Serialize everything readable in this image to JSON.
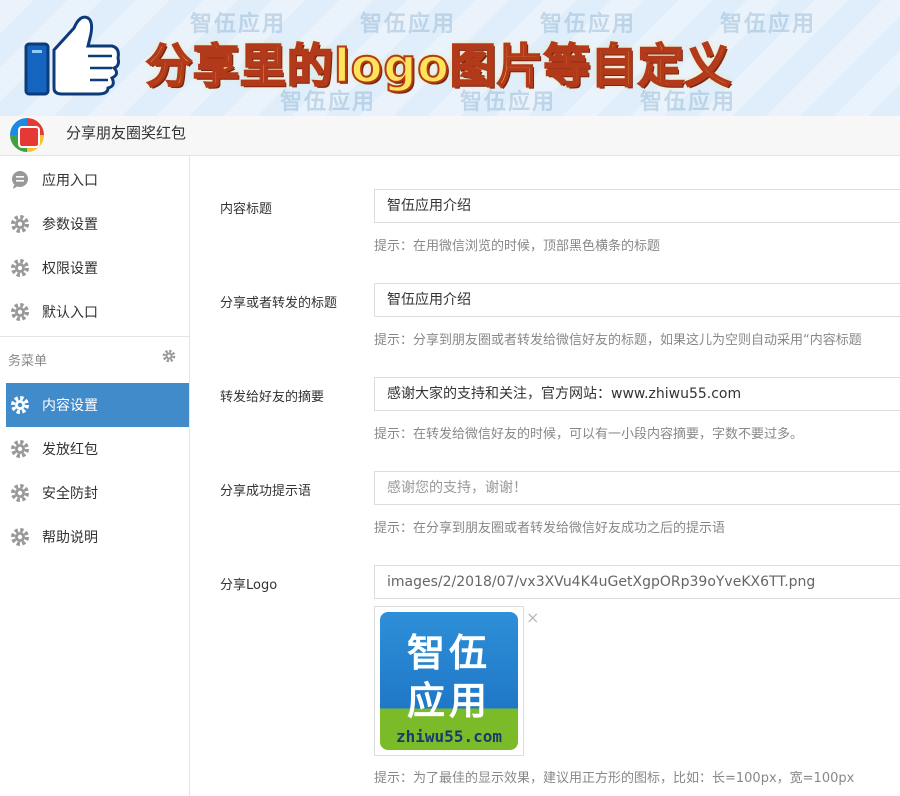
{
  "banner": {
    "title": "分享里的logo图片等自定义",
    "watermark": "智伍应用"
  },
  "app": {
    "title": "分享朋友圈奖红包"
  },
  "sidebar": {
    "items": [
      {
        "label": "应用入口",
        "icon": "chat-icon"
      },
      {
        "label": "参数设置",
        "icon": "gear-icon"
      },
      {
        "label": "权限设置",
        "icon": "gear-icon"
      },
      {
        "label": "默认入口",
        "icon": "gear-icon"
      }
    ],
    "group_label": "务菜单",
    "menu": [
      {
        "label": "内容设置",
        "icon": "gear-icon",
        "active": true
      },
      {
        "label": "发放红包",
        "icon": "gear-icon"
      },
      {
        "label": "安全防封",
        "icon": "gear-icon"
      },
      {
        "label": "帮助说明",
        "icon": "gear-icon"
      }
    ],
    "active_color": "#428bca"
  },
  "form": {
    "content_title": {
      "label": "内容标题",
      "value": "智伍应用介绍",
      "hint": "提示：在用微信浏览的时候，顶部黑色横条的标题"
    },
    "share_title": {
      "label": "分享或者转发的标题",
      "value": "智伍应用介绍",
      "hint": "提示：分享到朋友圈或者转发给微信好友的标题，如果这儿为空则自动采用“内容标题"
    },
    "summary": {
      "label": "转发给好友的摘要",
      "value": "感谢大家的支持和关注，官方网站：www.zhiwu55.com",
      "hint": "提示：在转发给微信好友的时候，可以有一小段内容摘要，字数不要过多。"
    },
    "success_msg": {
      "label": "分享成功提示语",
      "placeholder": "感谢您的支持，谢谢！",
      "hint": "提示：在分享到朋友圈或者转发给微信好友成功之后的提示语"
    },
    "logo": {
      "label": "分享Logo",
      "value": "images/2/2018/07/vx3XVu4K4uGetXgpORp39oYveKX6TT.png",
      "hint": "提示：为了最佳的显示效果，建议用正方形的图标，比如：长=100px，宽=100px",
      "image_line1": "智伍",
      "image_line2": "应用",
      "image_url": "zhiwu55.com",
      "close": "×"
    }
  }
}
